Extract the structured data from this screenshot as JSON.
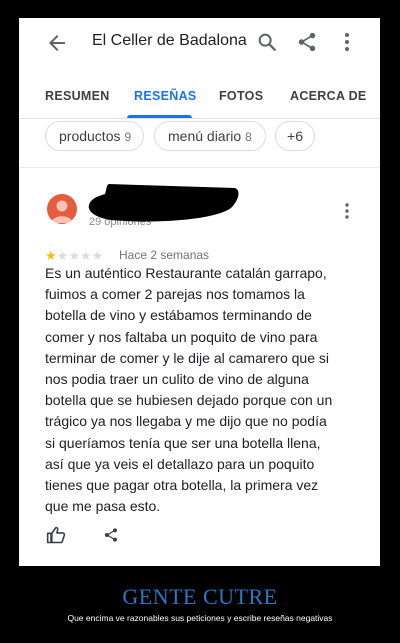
{
  "header": {
    "title": "El Celler de Badalona",
    "icons": [
      "back-arrow-icon",
      "search-icon",
      "share-icon",
      "more-vert-icon"
    ]
  },
  "tabs": [
    {
      "label": "RESUMEN",
      "active": false
    },
    {
      "label": "RESEÑAS",
      "active": true
    },
    {
      "label": "FOTOS",
      "active": false
    },
    {
      "label": "ACERCA DE",
      "active": false
    }
  ],
  "filters": [
    {
      "label": "productos",
      "count": "9"
    },
    {
      "label": "menú diario",
      "count": "8"
    },
    {
      "label": "+6",
      "count": ""
    }
  ],
  "review": {
    "opinions": "29 opiniones",
    "rating": 1,
    "max_rating": 5,
    "date": "Hace 2 semanas",
    "text": "Es un auténtico Restaurante catalán garrapo,\nfuimos a comer 2 parejas nos tomamos la\nbotella de vino y estábamos terminando de\ncomer y nos faltaba un poquito de vino para\nterminar de comer y le dije al camarero que si\nnos podia traer un culito de vino de alguna\nbotella que se hubiesen dejado porque con un\ntrágico ya nos llegaba y me dijo que no podía\nsi queríamos tenía que ser una botella llena,\nasí que ya veis el detallazo para un poquito\ntienes que pagar otra botella, la primera vez\nque me pasa esto."
  },
  "caption": {
    "title": "GENTE CUTRE",
    "subtitle": "Que encima ve razonables sus peticiones y escribe reseñas negativas"
  },
  "colors": {
    "accent": "#1a73e8",
    "star": "#fbbc04",
    "avatar": "#e65c3e",
    "caption_title": "#2b76c5"
  }
}
